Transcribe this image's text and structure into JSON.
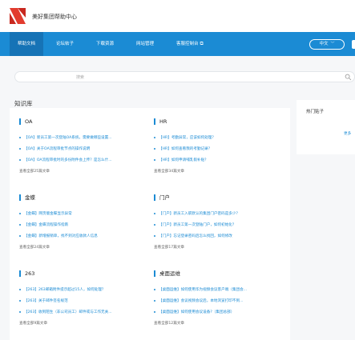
{
  "header": {
    "brand": "美好集团帮助中心",
    "logo_colors": [
      "#e23b2e",
      "#c8281f"
    ]
  },
  "nav": {
    "items": [
      {
        "label": "帮助文档",
        "active": true
      },
      {
        "label": "论坛帖子"
      },
      {
        "label": "下载资源"
      },
      {
        "label": "网站管理"
      },
      {
        "label": "客服控制台",
        "external_icon": "external-link-icon"
      }
    ],
    "language": "中文"
  },
  "search": {
    "placeholder": "搜索"
  },
  "knowledge": {
    "title": "知识库",
    "sections": [
      {
        "title": "OA",
        "items": [
          "【OA】新员工第一次登陆OA系统，需要做哪些设置...",
          "【OA】关于OA流程审批节点的操作说明",
          "【OA】OA流程审批时的多份附件会上传？是怎么什..."
        ],
        "count": "查看全部25篇文章"
      },
      {
        "title": "HR",
        "items": [
          "【HR】考勤异常，应该如何处理？",
          "【HR】如何查看我的考勤记录？",
          "【HR】如何申请哺乳假补贴？"
        ],
        "count": "查看全部34篇文章"
      },
      {
        "title": "金蝶",
        "items": [
          "【金蝶】网页版金蝶显示异常",
          "【金蝶】金蝶流程操作指南",
          "【金蝶】新增报销单，找不到对应收款人信息"
        ],
        "count": "查看全部24篇文章"
      },
      {
        "title": "门户",
        "items": [
          "【门户】新员工入职默认的集团门户密码是多少？",
          "【门户】新员工第一次登陆门户，如何初始化？",
          "【门户】忘记登录密码后怎么找回，如何修改"
        ],
        "count": "查看全部17篇文章"
      },
      {
        "title": "263",
        "items": [
          "【263】263邮箱附件提示超过15人，如何处理？",
          "【263】关于邮件签名规范",
          "【263】收到陌生（非公司员工）邮件或与工作无关..."
        ],
        "count": "查看全部9篇文章"
      },
      {
        "title": "桌面运维",
        "items": [
          "【桌面运维】如何使用华为视频会议客户端（集团会...",
          "【桌面运维】会议视频会议后，本地浏览打印不到...",
          "【桌面运维】如何使用会议设备?（集团总部）"
        ],
        "count": "查看全部12篇文章"
      }
    ]
  },
  "sidebar": {
    "title": "热门贴子",
    "more": "更多"
  },
  "colors": {
    "accent": "#1b8bd4",
    "nav_active": "#1673b6",
    "page_bg": "#f6f7f9"
  }
}
